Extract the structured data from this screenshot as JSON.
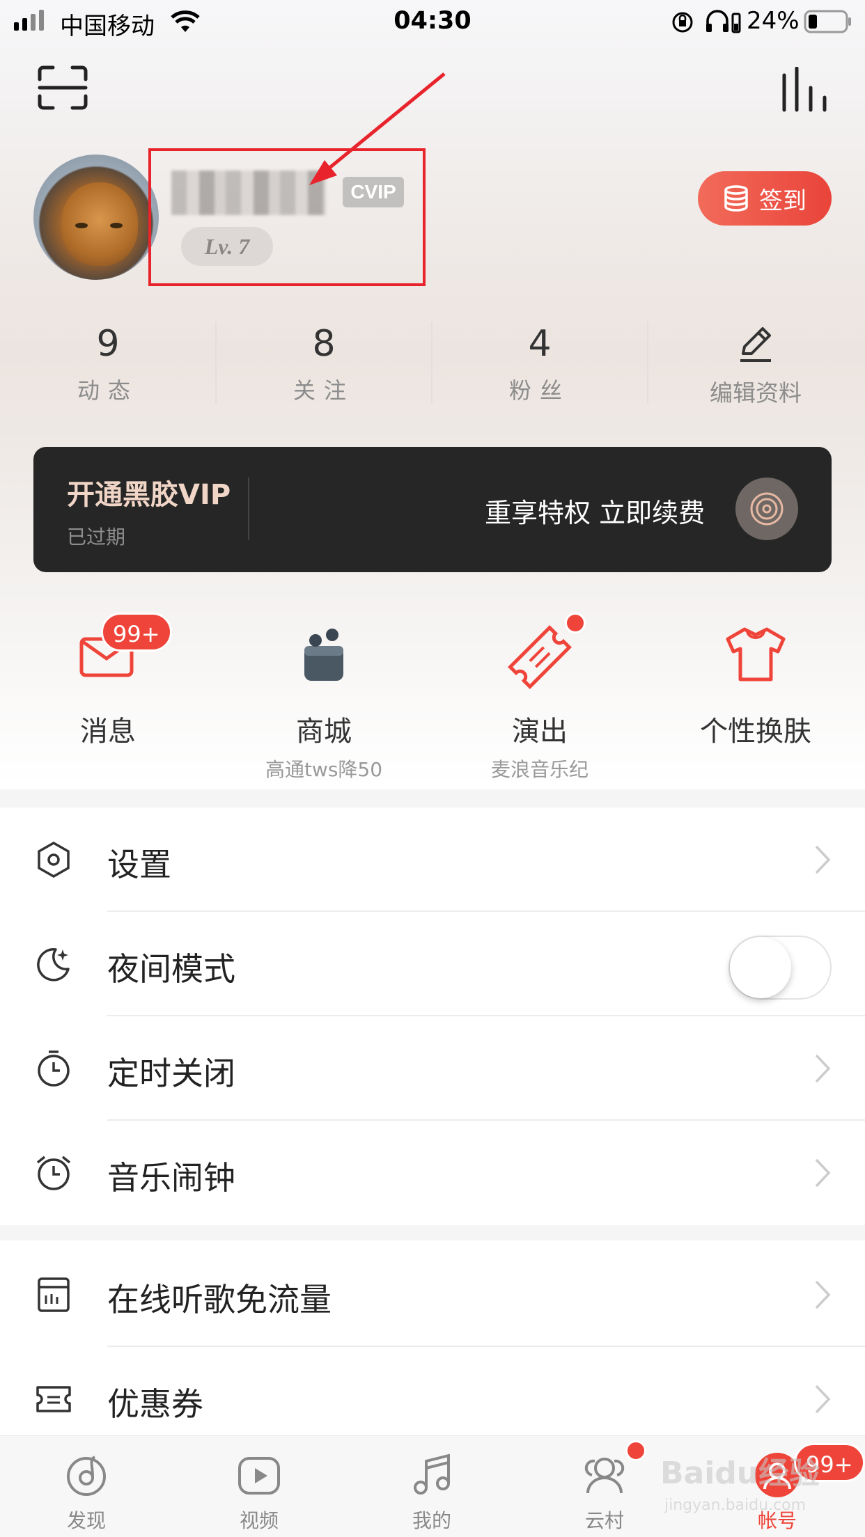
{
  "status_bar": {
    "carrier": "中国移动",
    "time": "04:30",
    "battery": "24%"
  },
  "profile": {
    "vip_badge": "CVIP",
    "level": "Lv. 7",
    "signin_label": "签到"
  },
  "stats": [
    {
      "value": "9",
      "label": "动态"
    },
    {
      "value": "8",
      "label": "关注"
    },
    {
      "value": "4",
      "label": "粉丝"
    }
  ],
  "edit_profile_label": "编辑资料",
  "vip_card": {
    "title": "开通黑胶VIP",
    "status": "已过期",
    "cta": "重享特权 立即续费"
  },
  "quick_entries": [
    {
      "label": "消息",
      "sub": "",
      "badge": "99+",
      "icon": "mail-icon"
    },
    {
      "label": "商城",
      "sub": "高通tws降50",
      "icon": "earbuds-icon"
    },
    {
      "label": "演出",
      "sub": "麦浪音乐纪",
      "icon": "ticket-icon"
    },
    {
      "label": "个性换肤",
      "sub": "",
      "icon": "tshirt-icon"
    }
  ],
  "menu_group_1": [
    {
      "label": "设置",
      "icon": "hexagon-settings-icon"
    },
    {
      "label": "夜间模式",
      "icon": "moon-icon",
      "toggle": false
    },
    {
      "label": "定时关闭",
      "icon": "timer-icon"
    },
    {
      "label": "音乐闹钟",
      "icon": "alarm-clock-icon"
    }
  ],
  "menu_group_2": [
    {
      "label": "在线听歌免流量",
      "icon": "sim-card-icon"
    },
    {
      "label": "优惠券",
      "icon": "coupon-icon"
    }
  ],
  "tab_bar": [
    {
      "label": "发现",
      "icon": "discover-icon"
    },
    {
      "label": "视频",
      "icon": "video-icon"
    },
    {
      "label": "我的",
      "icon": "music-note-icon"
    },
    {
      "label": "云村",
      "icon": "community-icon"
    },
    {
      "label": "帐号",
      "icon": "account-icon",
      "active": true,
      "badge": "99+"
    }
  ],
  "watermark": {
    "text": "Baidu经验",
    "sub": "jingyan.baidu.com"
  },
  "colors": {
    "accent": "#ef4439",
    "vip_card": "#262626",
    "annotation": "#e8232b"
  }
}
